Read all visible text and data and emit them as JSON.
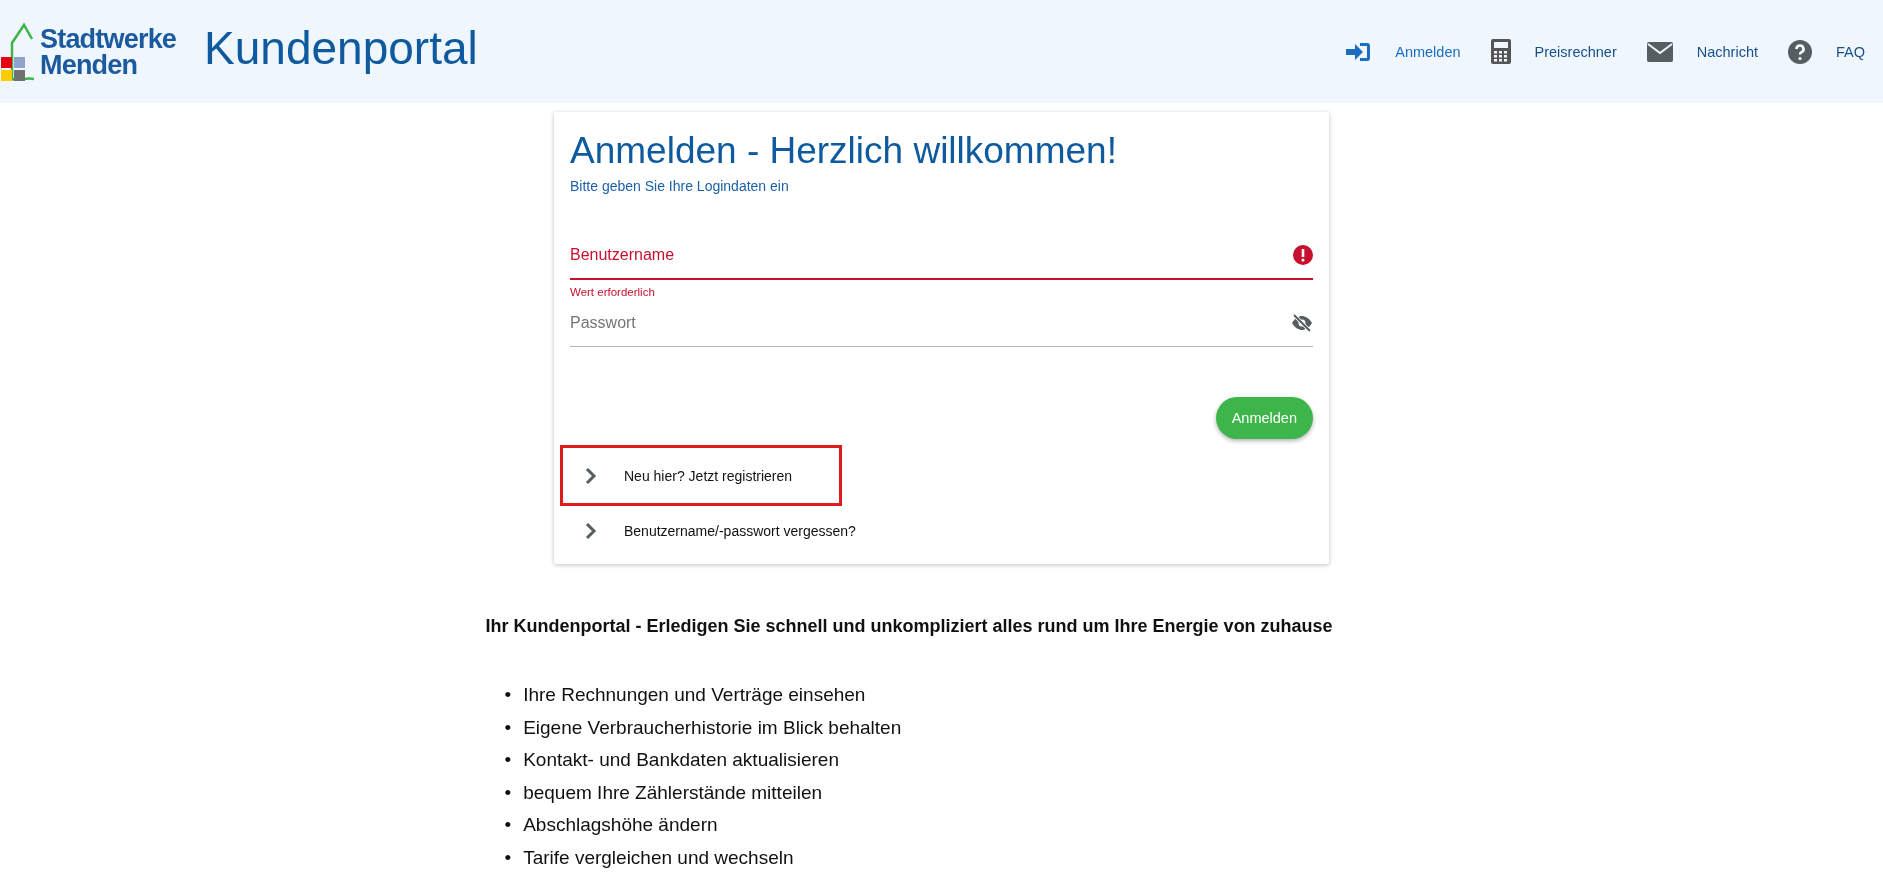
{
  "header": {
    "logo_lines": [
      "Stadtwerke",
      "Menden"
    ],
    "title": "Kundenportal",
    "nav": [
      {
        "kind": "login",
        "label": "Anmelden",
        "selected": true
      },
      {
        "kind": "calculator",
        "label": "Preisrechner",
        "selected": false
      },
      {
        "kind": "mail",
        "label": "Nachricht",
        "selected": false
      },
      {
        "kind": "help",
        "label": "FAQ",
        "selected": false
      }
    ]
  },
  "login_card": {
    "title": "Anmelden - Herzlich willkommen!",
    "subtitle": "Bitte geben Sie Ihre Logindaten ein",
    "fields": [
      {
        "kind": "text",
        "placeholder": "Benutzername",
        "invalid": true,
        "error": "Wert erforderlich"
      },
      {
        "kind": "password",
        "placeholder": "Passwort",
        "invalid": false
      }
    ],
    "submit": "Anmelden",
    "links": [
      {
        "label": "Neu hier? Jetzt registrieren",
        "highlighted": true
      },
      {
        "label": "Benutzername/-passwort vergessen?",
        "highlighted": false
      }
    ]
  },
  "intro": {
    "heading": "Ihr Kundenportal - Erledigen Sie schnell und unkompliziert alles rund um Ihre Energie von zuhause",
    "items": [
      {
        "marker": "•",
        "text": "Ihre Rechnungen und Verträge einsehen"
      },
      {
        "marker": "•",
        "text": "Eigene Verbraucherhistorie im Blick behalten"
      },
      {
        "marker": "•",
        "text": "Kontakt- und Bankdaten aktualisieren"
      },
      {
        "marker": "•",
        "text": "bequem Ihre Zählerstände mitteilen"
      },
      {
        "marker": "•",
        "text": "Abschlagshöhe ändern"
      },
      {
        "marker": "•",
        "text": "Tarife vergleichen und wechseln"
      }
    ]
  }
}
